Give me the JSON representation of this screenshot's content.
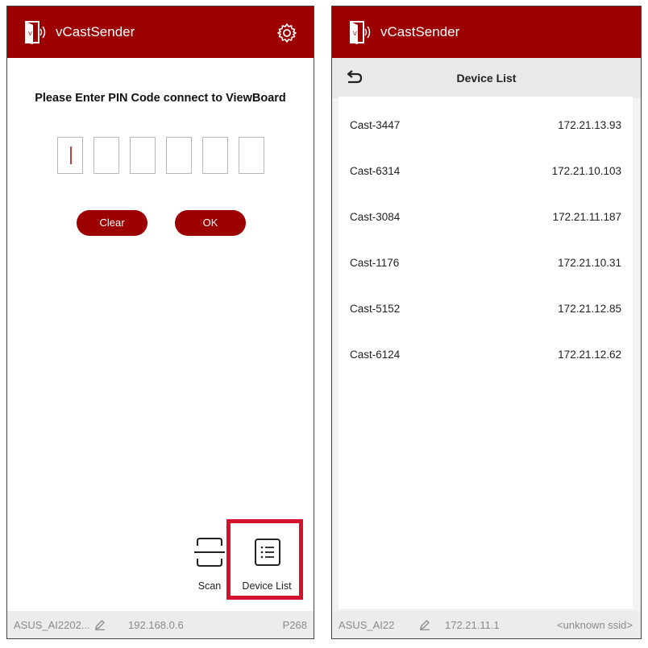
{
  "left": {
    "app_title": "vCastSender",
    "pin_title": "Please Enter PIN Code connect to ViewBoard",
    "clear_label": "Clear",
    "ok_label": "OK",
    "scan_label": "Scan",
    "device_list_label": "Device List",
    "status": {
      "device_name": "ASUS_AI2202...",
      "ip": "192.168.0.6",
      "tail": "P268"
    }
  },
  "right": {
    "app_title": "vCastSender",
    "page_title": "Device List",
    "devices": [
      {
        "name": "Cast-3447",
        "ip": "172.21.13.93"
      },
      {
        "name": "Cast-6314",
        "ip": "172.21.10.103"
      },
      {
        "name": "Cast-3084",
        "ip": "172.21.11.187"
      },
      {
        "name": "Cast-1176",
        "ip": "172.21.10.31"
      },
      {
        "name": "Cast-5152",
        "ip": "172.21.12.85"
      },
      {
        "name": "Cast-6124",
        "ip": "172.21.12.62"
      }
    ],
    "status": {
      "device_name": "ASUS_AI22",
      "ip": "172.21.11.1",
      "ssid": "<unknown ssid>"
    }
  },
  "colors": {
    "brand": "#9c0000",
    "highlight": "#d3132c"
  }
}
